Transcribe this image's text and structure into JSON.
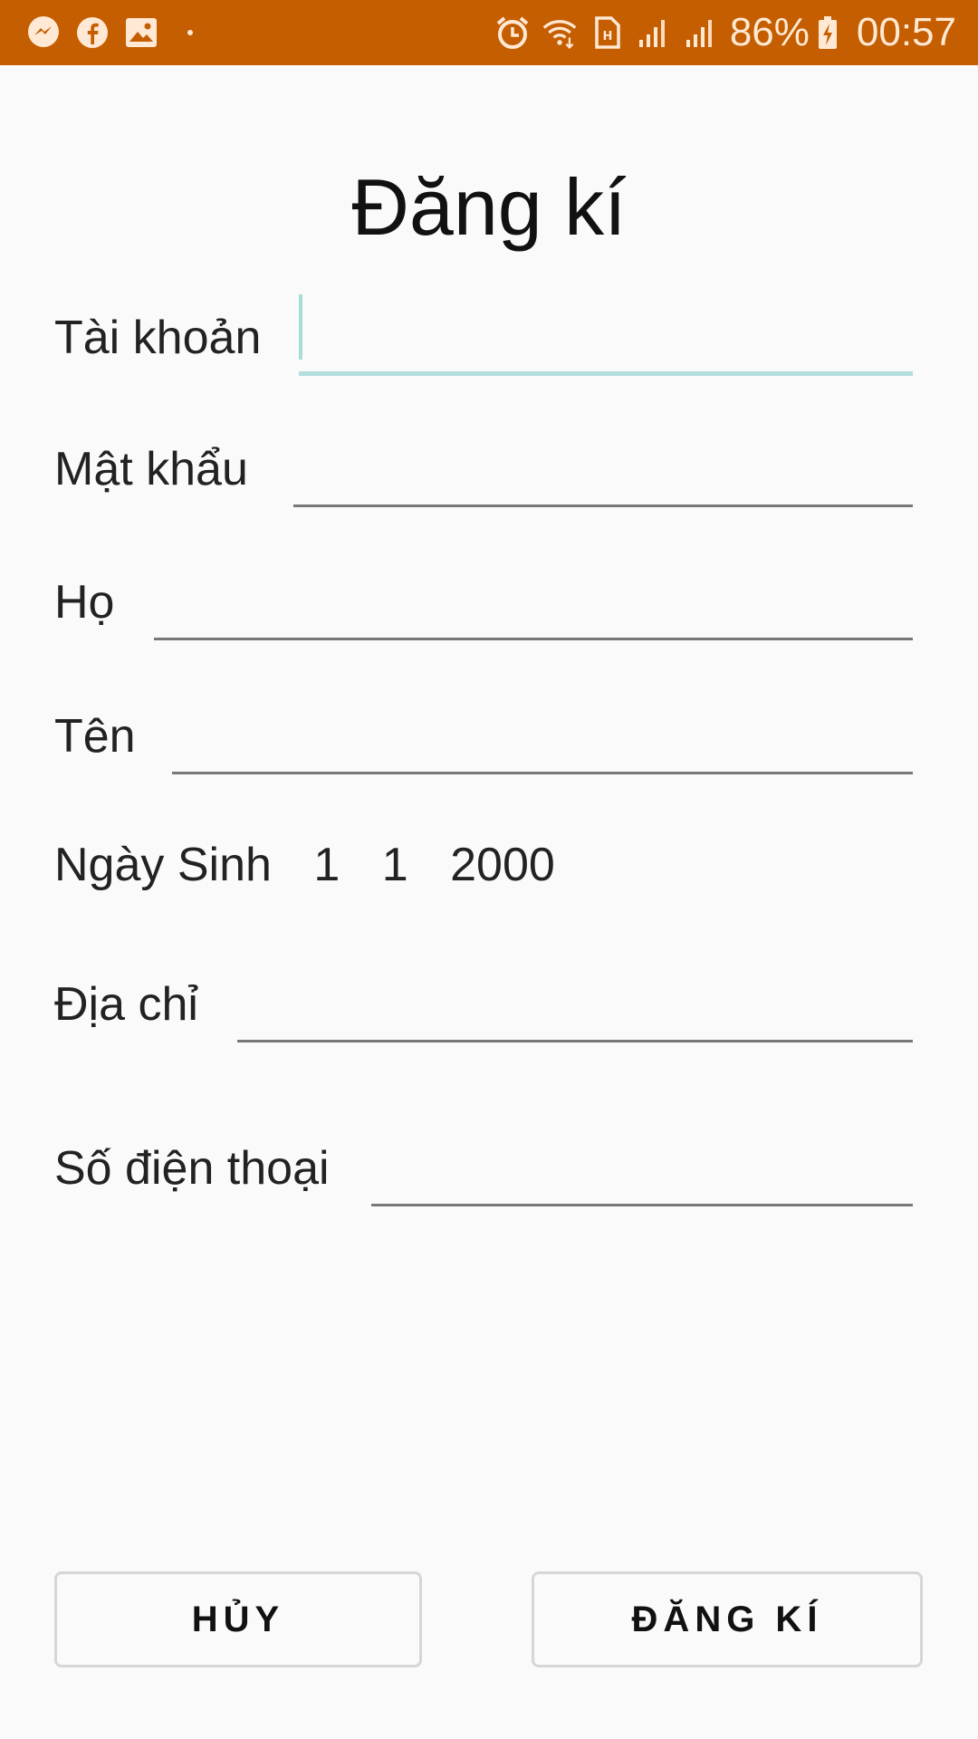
{
  "status_bar": {
    "battery_percent": "86%",
    "time": "00:57",
    "left_icons": [
      "messenger-icon",
      "facebook-icon",
      "gallery-icon",
      "dot-icon"
    ],
    "right_icons": [
      "alarm-icon",
      "wifi-icon",
      "volte-icon",
      "signal-icon",
      "signal-icon",
      "battery-charging-icon"
    ],
    "color": "#c45e00"
  },
  "form": {
    "title": "Đăng kí",
    "fields": [
      {
        "label": "Tài khoản",
        "value": ""
      },
      {
        "label": "Mật khẩu",
        "value": ""
      },
      {
        "label": "Họ",
        "value": ""
      },
      {
        "label": "Tên",
        "value": ""
      },
      {
        "label": "Địa chỉ",
        "value": ""
      },
      {
        "label": "Số điện thoại",
        "value": ""
      }
    ],
    "dob": {
      "label": "Ngày Sinh",
      "day": "1",
      "month": "1",
      "year": "2000"
    }
  },
  "buttons": {
    "cancel": "HỦY",
    "register": "ĐĂNG KÍ"
  }
}
